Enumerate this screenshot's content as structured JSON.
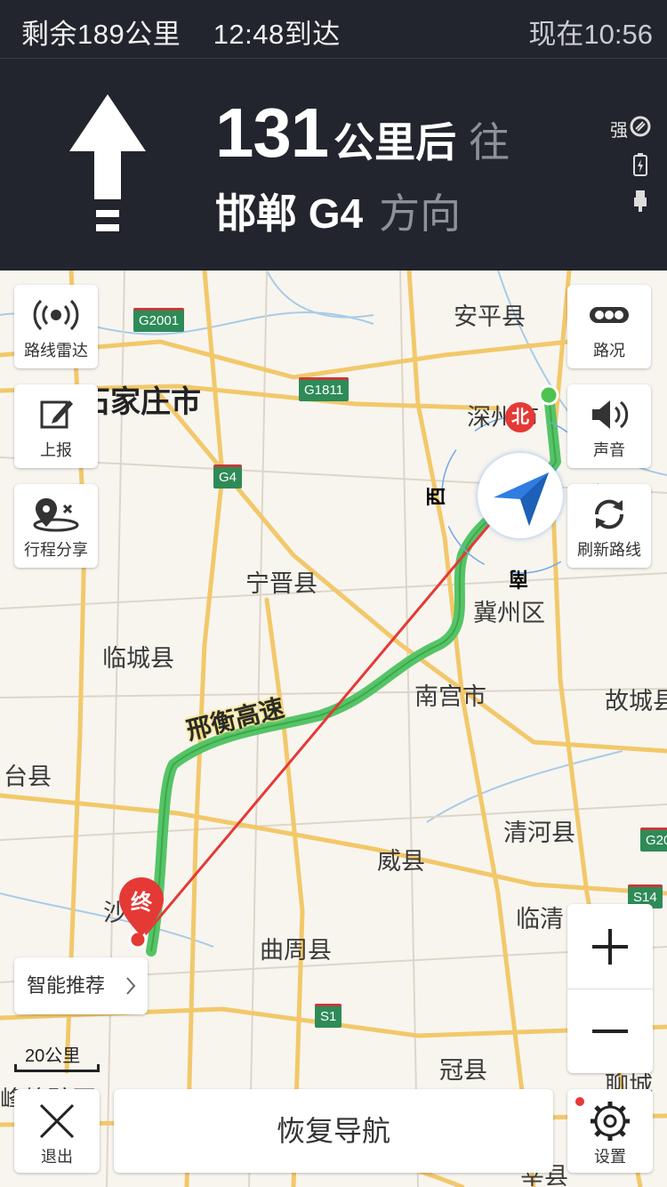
{
  "status": {
    "remaining": "剩余189公里",
    "eta": "12:48到达",
    "now": "现在10:56"
  },
  "guidance": {
    "distance_value": "131",
    "distance_unit": "公里后",
    "toward": "往",
    "road": "邯郸 G4",
    "direction": "方向",
    "signal_label": "强"
  },
  "map": {
    "cities": {
      "anping": "安平县",
      "shijiazhuang": "石家庄市",
      "shenzhou": "深州市",
      "ningjin": "宁晋县",
      "jizhou": "冀州区",
      "lincheng": "临城县",
      "nangong": "南宫市",
      "gucheng": "故城县",
      "xingtai": "台县",
      "qinghe": "清河县",
      "weixian": "威县",
      "linqing": "临清",
      "shahe": "沙河",
      "quzhou": "曲周县",
      "guanxian": "冠县",
      "shencheng": "聊城",
      "fengfeng": "峰峰矿区",
      "xinxian": "莘县"
    },
    "shields": {
      "g2001": "G2001",
      "g1811": "G1811",
      "g4": "G4",
      "s1": "S1",
      "s14": "S14",
      "g20": "G20"
    },
    "road_label": "邢衡高速",
    "compass": {
      "north": "北",
      "west": "西",
      "south": "南"
    },
    "end_marker": "终"
  },
  "tools": {
    "radar": "路线雷达",
    "report": "上报",
    "share": "行程分享",
    "traffic": "路况",
    "sound": "声音",
    "refresh": "刷新路线"
  },
  "recommend": "智能推荐",
  "scale": "20公里",
  "bottom": {
    "exit": "退出",
    "resume": "恢复导航",
    "settings": "设置"
  },
  "colors": {
    "header_bg": "#22252d",
    "route_green": "#55c466",
    "route_red": "#e53935",
    "accent_blue": "#2f7de1"
  }
}
